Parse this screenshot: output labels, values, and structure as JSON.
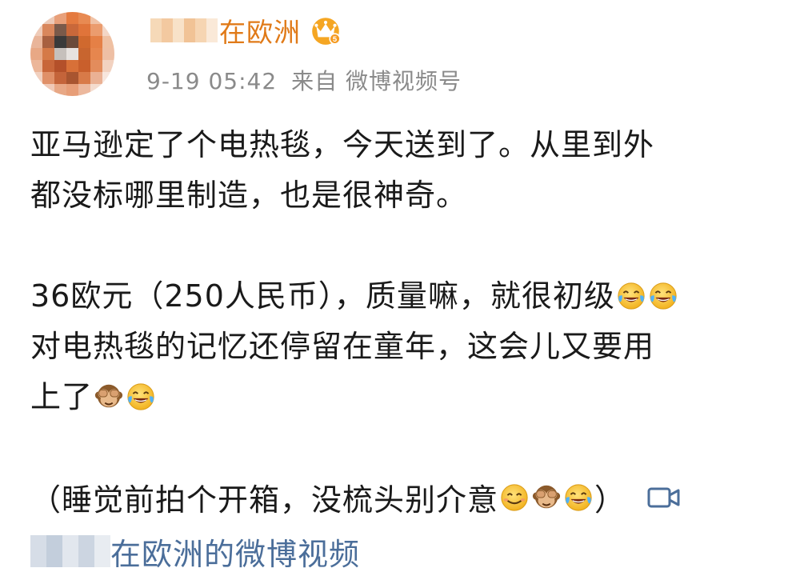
{
  "post": {
    "author_name": "在欧洲",
    "author_badge_icon": "crown-vip-icon",
    "time": "9-19 05:42",
    "source": "来自 微博视频号",
    "paragraph1_line1": "亚马逊定了个电热毯，今天送到了。从里到外",
    "paragraph1_line2": "都没标哪里制造，也是很神奇。",
    "paragraph2_line1": "36欧元（250人民币），质量嘛，就很初级",
    "paragraph2_line2": "对电热毯的记忆还停留在童年，这会儿又要用",
    "paragraph2_line3": "上了",
    "paragraph3": "（睡觉前拍个开箱，没梳头别介意",
    "paragraph3_end": "）",
    "video_link": "在欧洲的微博视频"
  },
  "emoji_names": [
    "laughing-crying-emoji",
    "see-no-evil-monkey-emoji",
    "smiling-emoji"
  ],
  "colors": {
    "name": "#e07a18",
    "meta": "#8a8a8a",
    "text": "#1a1a1a",
    "link": "#4b6e9a",
    "emoji_face": "#f7c23c"
  }
}
